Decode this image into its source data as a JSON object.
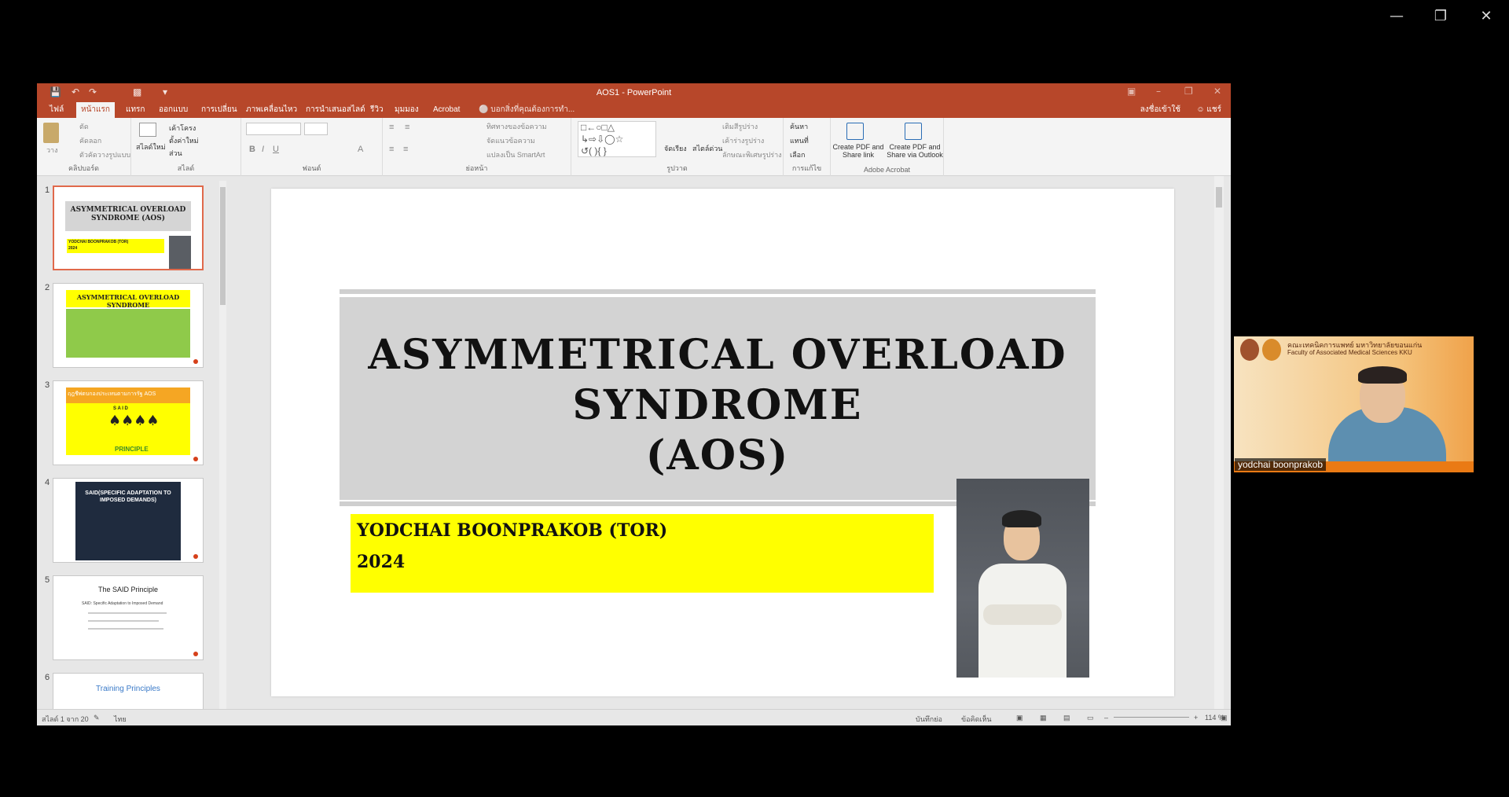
{
  "outer_window": {
    "controls": [
      "minimize",
      "restore",
      "close"
    ]
  },
  "ppt": {
    "window_title": "AOS1 - PowerPoint",
    "tabs": [
      "ไฟล์",
      "หน้าแรก",
      "แทรก",
      "ออกแบบ",
      "การเปลี่ยน",
      "ภาพเคลื่อนไหว",
      "การนำเสนอสไลด์",
      "รีวิว",
      "มุมมอง",
      "Acrobat"
    ],
    "active_tab": "หน้าแรก",
    "tell_me": "บอกสิ่งที่คุณต้องการทำ...",
    "sign_in": "ลงชื่อเข้าใช้",
    "share": "แชร์",
    "ribbon": {
      "groups": [
        "คลิปบอร์ด",
        "สไลด์",
        "ฟอนต์",
        "ย่อหน้า",
        "รูปวาด",
        "การแก้ไข",
        "Adobe Acrobat"
      ],
      "clipboard": {
        "paste": "วาง",
        "cut": "ตัด",
        "copy": "คัดลอก",
        "format_painter": "ตัวคัดวางรูปแบบ"
      },
      "slides": {
        "new_slide": "สไลด์ใหม่",
        "layout": "เค้าโครง",
        "reset": "ตั้งค่าใหม่",
        "section": "ส่วน"
      },
      "paragraph": {
        "text_direction": "ทิศทางของข้อความ",
        "align_text": "จัดแนวข้อความ",
        "smartart": "แปลงเป็น SmartArt"
      },
      "drawing": {
        "arrange": "จัดเรียง",
        "quick_styles": "สไตล์ด่วน",
        "shape_fill": "เติมสีรูปร่าง",
        "shape_outline": "เค้าร่างรูปร่าง",
        "shape_effects": "ลักษณะพิเศษรูปร่าง"
      },
      "editing": {
        "find": "ค้นหา",
        "replace": "แทนที่",
        "select": "เลือก"
      },
      "acrobat": {
        "create_pdf_share": "Create PDF and Share link",
        "create_pdf_outlook": "Create PDF and Share via Outlook"
      }
    },
    "thumbnails": [
      {
        "num": "1",
        "title": "ASYMMETRICAL OVERLOAD SYNDROME (AOS)",
        "sub1": "YODCHAI BOONPRAKOB (TOR)",
        "sub2": "2024"
      },
      {
        "num": "2",
        "title": "ASYMMETRICAL OVERLOAD SYNDROME"
      },
      {
        "num": "3",
        "title": "ฤฎชีพ่ตบกองประเทนตามการรัฐ AOS",
        "word": "PRINCIPLE",
        "said": "S A I D"
      },
      {
        "num": "4",
        "title": "SAID(SPECIFIC ADAPTATION TO IMPOSED DEMANDS)"
      },
      {
        "num": "5",
        "title": "The SAID Principle",
        "bullet": "SAID: Specific Adaptation to Imposed Demand"
      },
      {
        "num": "6",
        "title": "Training Principles"
      }
    ],
    "slide": {
      "title_line1": "ASYMMETRICAL OVERLOAD SYNDROME",
      "title_line2": "(AOS)",
      "subtitle_line1": "YODCHAI BOONPRAKOB (TOR)",
      "subtitle_line2": "2024"
    },
    "status": {
      "slide_count": "สไลด์ 1 จาก 20",
      "language": "ไทย",
      "notes": "บันทึกย่อ",
      "comments": "ข้อคิดเห็น",
      "zoom": "114 %"
    }
  },
  "webcam": {
    "banner_th": "คณะเทคนิคการแพทย์ มหาวิทยาลัยขอนแก่น",
    "banner_en": "Faculty of Associated Medical Sciences KKU",
    "name_tag": "yodchai boonprakob"
  },
  "colors": {
    "ppt_accent": "#b7472a",
    "slide_highlight": "#ffff00",
    "title_bg": "#d3d3d3"
  }
}
